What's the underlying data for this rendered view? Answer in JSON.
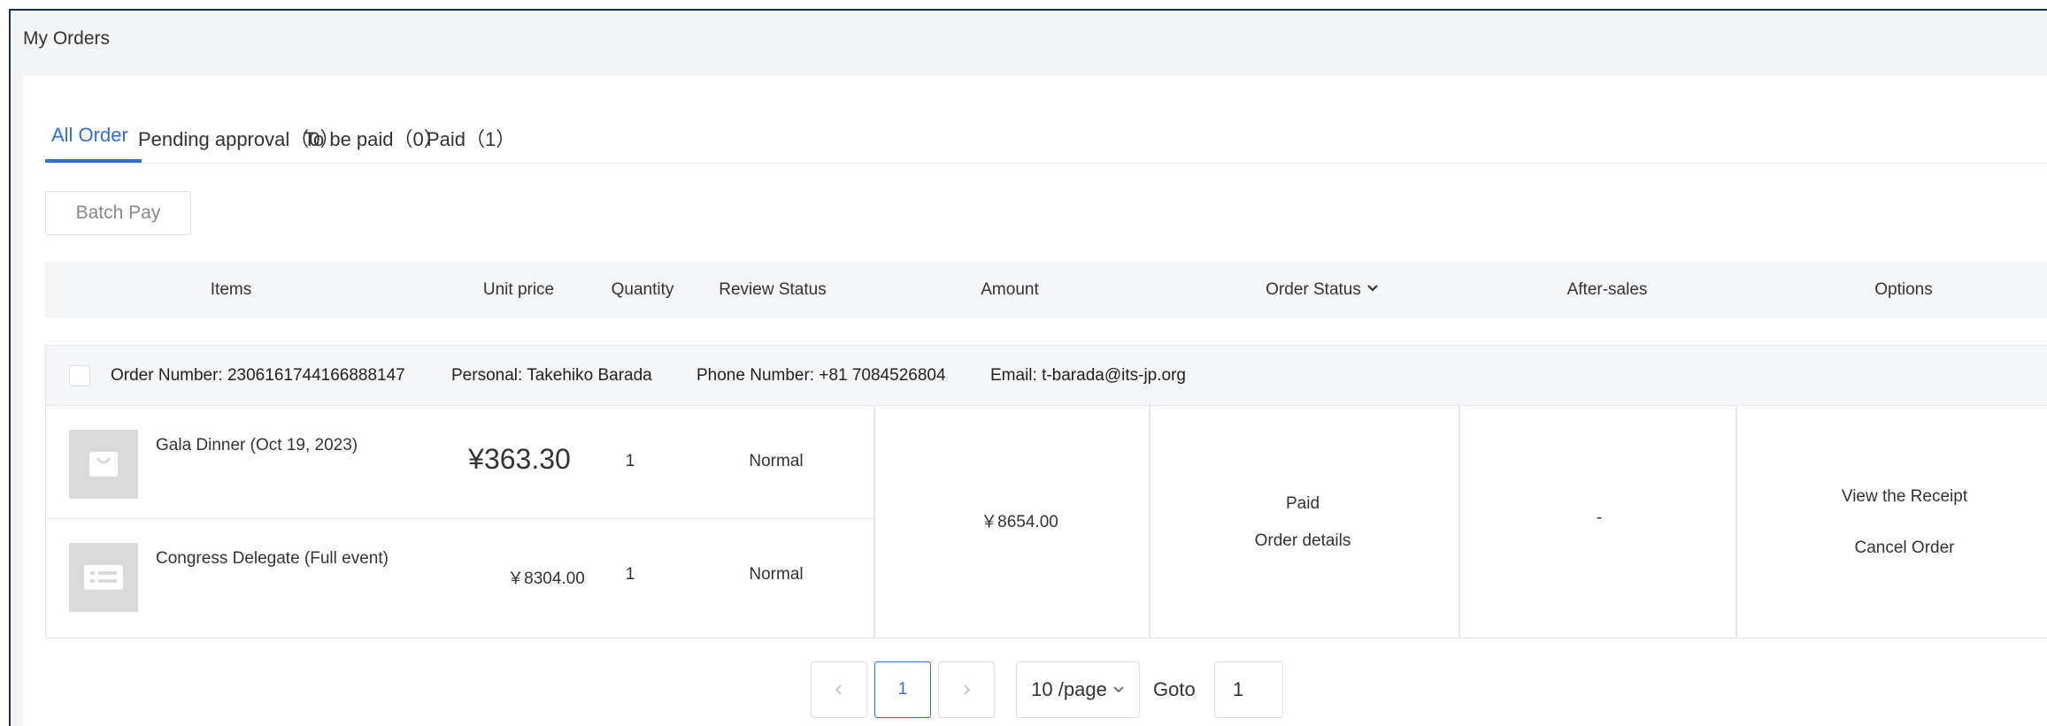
{
  "page": {
    "title": "My Orders"
  },
  "tabs": [
    {
      "label": "All Order",
      "active": true
    },
    {
      "label": "Pending approval（0）",
      "active": false
    },
    {
      "label": "To be paid（0）",
      "active": false
    },
    {
      "label": "Paid（1）",
      "active": false
    }
  ],
  "toolbar": {
    "batch_pay_label": "Batch Pay"
  },
  "table": {
    "headers": {
      "items": "Items",
      "unit_price": "Unit price",
      "quantity": "Quantity",
      "review_status": "Review Status",
      "amount": "Amount",
      "order_status": "Order Status",
      "after_sales": "After-sales",
      "options": "Options"
    }
  },
  "order": {
    "order_number": "Order Number: 2306161744166888147",
    "personal": "Personal: Takehiko Barada",
    "phone": "Phone Number: +81 7084526804",
    "email": "Email: t-barada@its-jp.org",
    "items": [
      {
        "name": "Gala Dinner (Oct 19, 2023)",
        "unit_price": "¥363.30",
        "quantity": "1",
        "review_status": "Normal",
        "icon": "shopping-bag-icon"
      },
      {
        "name": "Congress Delegate (Full event)",
        "unit_price": "￥8304.00",
        "quantity": "1",
        "review_status": "Normal",
        "icon": "ticket-list-icon"
      }
    ],
    "amount": "￥8654.00",
    "status": "Paid",
    "details_link": "Order details",
    "after_sales": "-",
    "options": {
      "view_receipt": "View the Receipt",
      "cancel": "Cancel Order"
    }
  },
  "pagination": {
    "current_page": "1",
    "page_size_label": "10 /page",
    "goto_label": "Goto",
    "goto_value": "1"
  },
  "colors": {
    "accent": "#2f6fd6",
    "header_bg": "#f5f6f8",
    "border": "#e4e7ed"
  }
}
